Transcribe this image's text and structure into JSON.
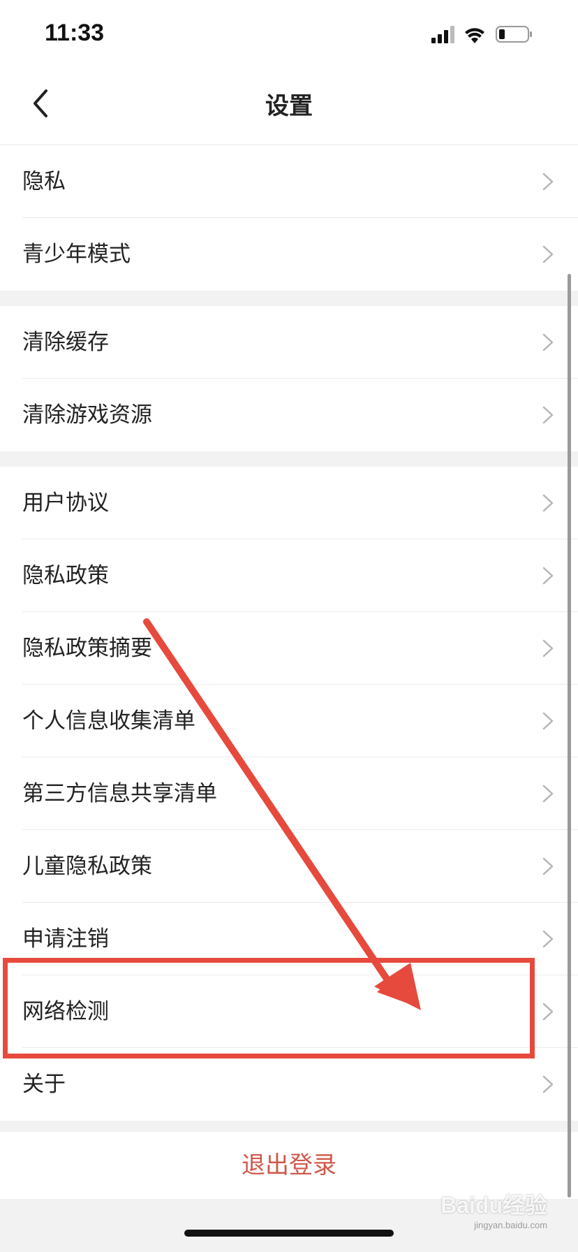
{
  "status_bar": {
    "time": "11:33"
  },
  "header": {
    "title": "设置"
  },
  "groups": [
    {
      "items": [
        {
          "label": "隐私"
        },
        {
          "label": "青少年模式"
        }
      ]
    },
    {
      "items": [
        {
          "label": "清除缓存"
        },
        {
          "label": "清除游戏资源"
        }
      ]
    },
    {
      "items": [
        {
          "label": "用户协议"
        },
        {
          "label": "隐私政策"
        },
        {
          "label": "隐私政策摘要"
        },
        {
          "label": "个人信息收集清单"
        },
        {
          "label": "第三方信息共享清单"
        },
        {
          "label": "儿童隐私政策"
        },
        {
          "label": "申请注销"
        },
        {
          "label": "网络检测"
        },
        {
          "label": "关于"
        }
      ]
    }
  ],
  "logout": {
    "label": "退出登录"
  },
  "watermark": {
    "brand": "Baidu经验",
    "url": "jingyan.baidu.com"
  },
  "colors": {
    "accent_red": "#d0584a",
    "annotation_red": "#e64a3c",
    "background": "#f2f2f2"
  },
  "icons": {
    "back": "chevron-left-icon",
    "row": "chevron-right-icon"
  }
}
